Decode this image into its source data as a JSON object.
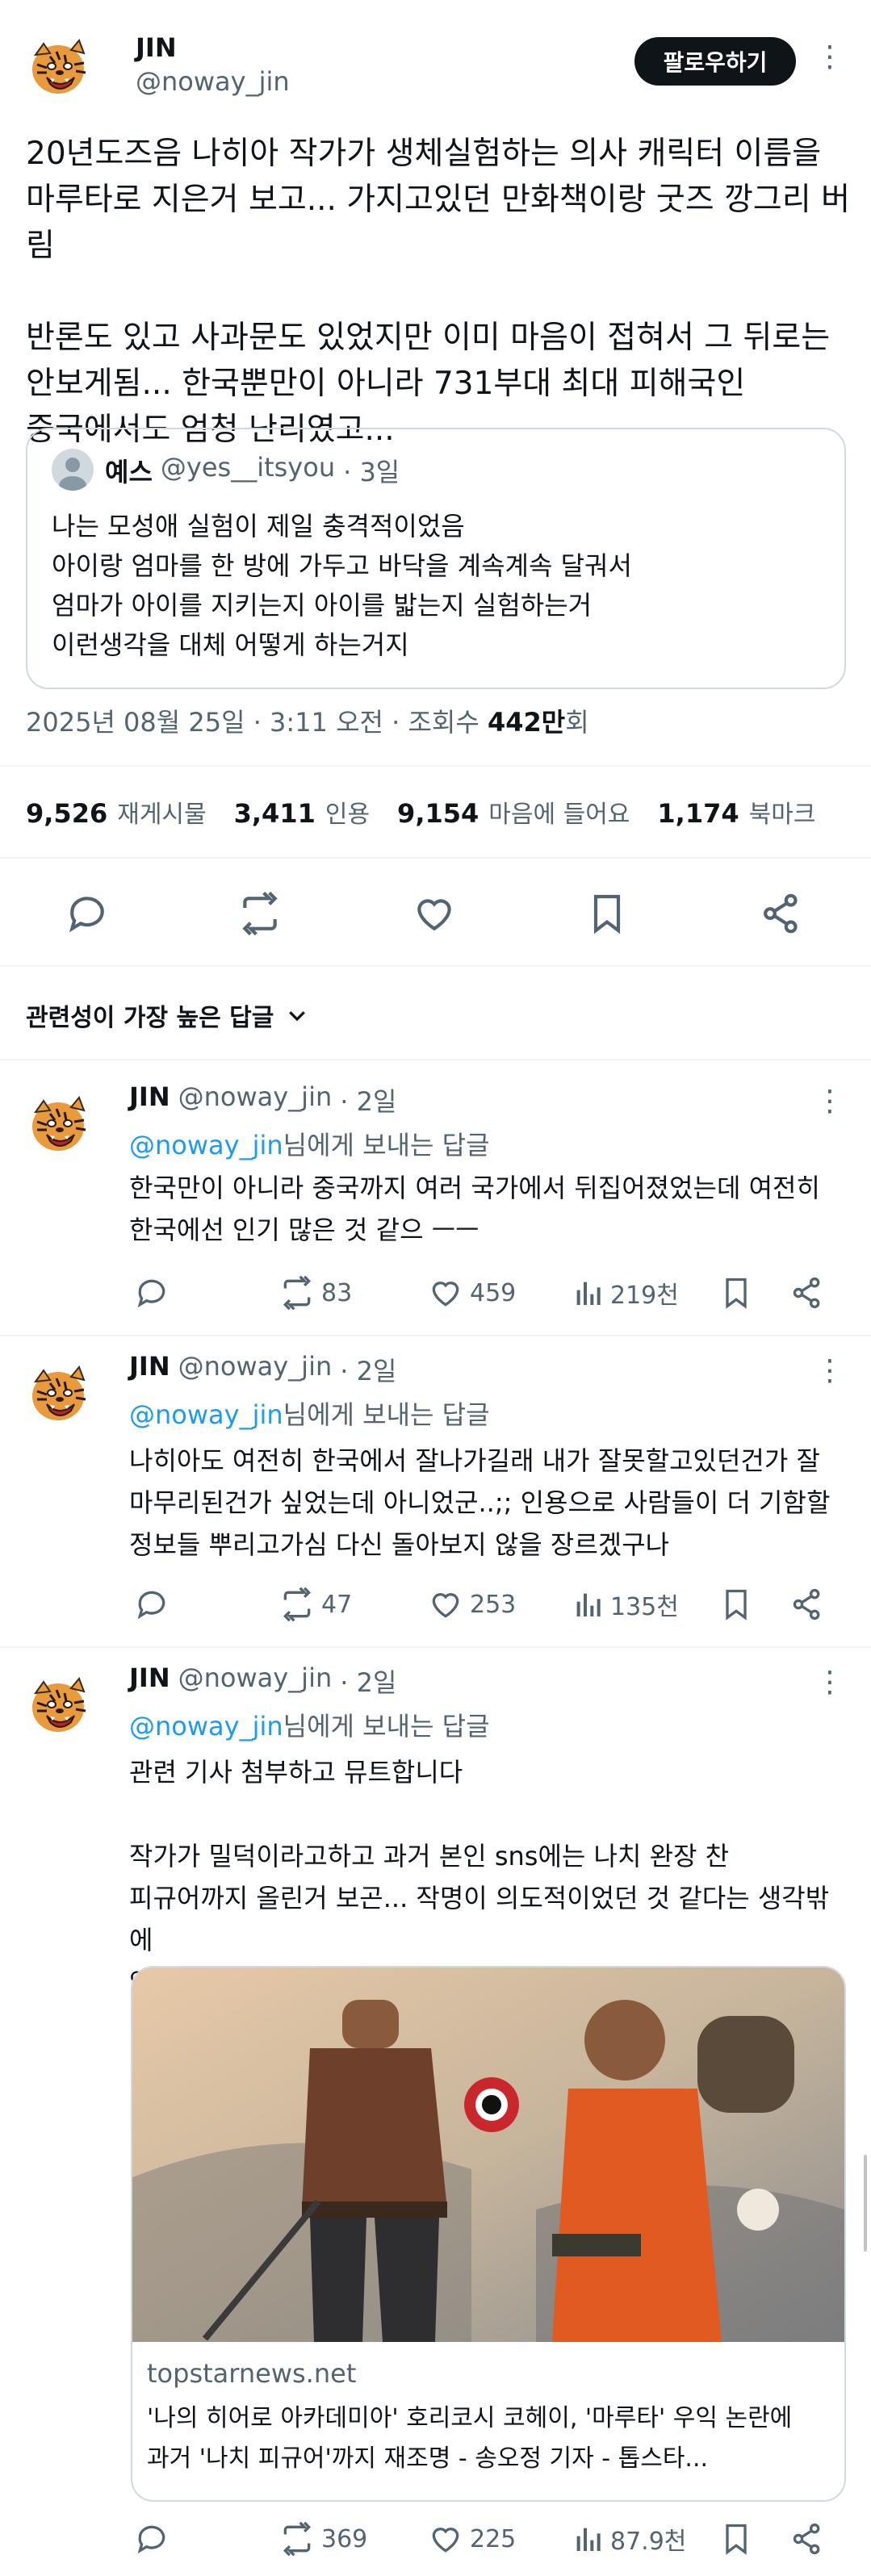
{
  "main": {
    "name": "JIN",
    "handle": "@noway_jin",
    "follow_label": "팔로우하기",
    "text_p1_l1": "20년도즈음 나히아 작가가 생체실험하는 의사 캐릭터 이름을",
    "text_p1_l2": "마루타로 지은거 보고... 가지고있던 만화책이랑 굿즈 깡그리 버림",
    "text_p2_l1": "반론도 있고 사과문도 있었지만 이미 마음이 접혀서 그 뒤로는",
    "text_p2_l2": "안보게됨... 한국뿐만이 아니라 731부대 최대 피해국인",
    "text_p2_l3": "중국에서도 엄청 난리였고...",
    "quote": {
      "name": "예스",
      "handle": "@yes__itsyou",
      "time": "· 3일",
      "lines": [
        "나는 모성애 실험이 제일 충격적이었음",
        "아이랑 엄마를 한 방에 가두고 바닥을 계속계속 달궈서",
        "엄마가 아이를 지키는지 아이를 밟는지 실험하는거",
        "이런생각을 대체 어떻게 하는거지"
      ]
    },
    "timestamp": "2025년 08월 25일 · 3:11 오전 · 조회수",
    "views": "442만",
    "views_suffix": "회",
    "stats": [
      {
        "num": "9,526",
        "label": "재게시물"
      },
      {
        "num": "3,411",
        "label": "인용"
      },
      {
        "num": "9,154",
        "label": "마음에 들어요"
      },
      {
        "num": "1,174",
        "label": "북마크"
      }
    ]
  },
  "sort_label": "관련성이 가장 높은 답글",
  "replies": [
    {
      "name": "JIN",
      "handle": "@noway_jin",
      "time": "· 2일",
      "reply_to": "@noway_jin",
      "reply_suffix": "님에게 보내는 답글",
      "lines": [
        "한국만이 아니라 중국까지 여러 국가에서 뒤집어졌었는데 여전히",
        "한국에선 인기 많은 것 같으 ㅡㅡ"
      ],
      "retweets": "83",
      "likes": "459",
      "views": "219천"
    },
    {
      "name": "JIN",
      "handle": "@noway_jin",
      "time": "· 2일",
      "reply_to": "@noway_jin",
      "reply_suffix": "님에게 보내는 답글",
      "lines": [
        "나히아도 여전히 한국에서 잘나가길래 내가 잘못할고있던건가 잘",
        "마무리된건가 싶었는데 아니었군..;; 인용으로 사람들이 더 기함할",
        "정보들 뿌리고가심 다신 돌아보지 않을 장르겠구나"
      ],
      "retweets": "47",
      "likes": "253",
      "views": "135천"
    },
    {
      "name": "JIN",
      "handle": "@noway_jin",
      "time": "· 2일",
      "reply_to": "@noway_jin",
      "reply_suffix": "님에게 보내는 답글",
      "lines": [
        "관련 기사 첨부하고 뮤트합니다",
        "",
        "작가가 밀덕이라고하고  과거 본인 sns에는 나치 완장 찬",
        "피규어까지 올린거 보곤... 작명이 의도적이었던 것 같다는 생각밖에",
        "안드네요;;"
      ],
      "retweets": "369",
      "likes": "225",
      "views": "87.9천",
      "card": {
        "domain": "topstarnews.net",
        "title_l1": "'나의 히어로 아카데미아' 호리코시 코헤이, '마루타' 우익 논란에",
        "title_l2": "과거 '나치 피규어'까지 재조명 - 송오정 기자 - 톱스타..."
      }
    }
  ]
}
